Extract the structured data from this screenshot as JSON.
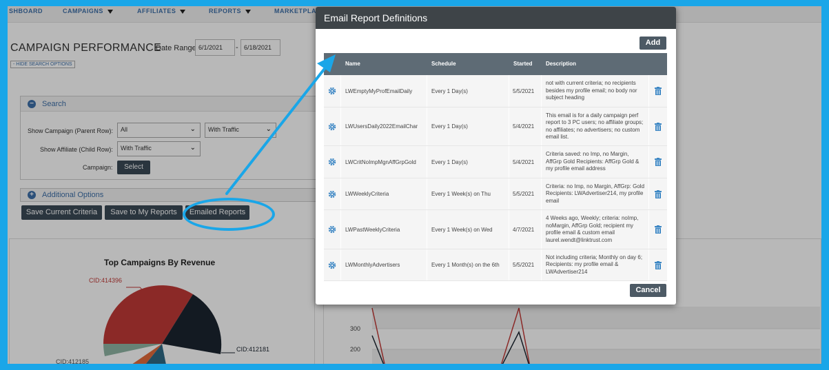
{
  "nav": {
    "items": [
      "SHBOARD",
      "CAMPAIGNS",
      "AFFILIATES",
      "REPORTS",
      "MARKETPLA"
    ]
  },
  "page": {
    "title": "CAMPAIGN PERFORMANCE",
    "date_range_label": "Date Range:",
    "date_from": "6/1/2021",
    "date_to": "6/18/2021",
    "date_sep": "-",
    "hide_search": "- HIDE SEARCH OPTIONS"
  },
  "search": {
    "title": "Search",
    "show_campaign_label": "Show Campaign (Parent Row):",
    "show_campaign_value": "All",
    "traffic_value": "With Traffic",
    "show_affiliate_label": "Show Affiliate (Child Row):",
    "show_affiliate_value": "With Traffic",
    "campaign_label": "Campaign:",
    "select_button": "Select"
  },
  "additional_options": {
    "title": "Additional Options"
  },
  "actions": {
    "save_criteria": "Save Current Criteria",
    "save_reports": "Save to My Reports",
    "emailed_reports": "Emailed Reports"
  },
  "chart": {
    "title": "Top Campaigns By Revenue",
    "labels": [
      "CID:414396",
      "CID:412181",
      "CID:412185"
    ],
    "axis_ticks": [
      "300",
      "200"
    ]
  },
  "modal": {
    "title": "Email Report Definitions",
    "add_button": "Add",
    "cancel_button": "Cancel",
    "columns": [
      "Name",
      "Schedule",
      "Started",
      "Description"
    ],
    "rows": [
      {
        "name": "LWEmptyMyProfEmailDaily",
        "schedule": "Every 1 Day(s)",
        "started": "5/5/2021",
        "description": "not with current criteria; no recipients besides my profile email; no body nor subject heading"
      },
      {
        "name": "LWUsersDaily2022EmailChar",
        "schedule": "Every 1 Day(s)",
        "started": "5/4/2021",
        "description": "This email is for a daily campaign perf report to 3 PC users; no affiliate groups; no affiliates; no advertisers; no custom email list."
      },
      {
        "name": "LWCritNoImpMgnAffGrpGold",
        "schedule": "Every 1 Day(s)",
        "started": "5/4/2021",
        "description": "Criteria saved: no Imp, no Margin, AffGrp Gold Recipients: AffGrp Gold & my profile email address"
      },
      {
        "name": "LWWeeklyCriteria",
        "schedule": "Every 1 Week(s) on Thu",
        "started": "5/5/2021",
        "description": "Criteria: no Imp, no Margin, AffGrp: Gold Recipients: LWAdvertiser214, my profile email"
      },
      {
        "name": "LWPastWeeklyCriteria",
        "schedule": "Every 1 Week(s) on Wed",
        "started": "4/7/2021",
        "description": "4 Weeks ago, Weekly; criteria: noImp, noMargin, AffGrp Gold; recipient my profile email & custom email laurel.wendt@linktrust.com"
      },
      {
        "name": "LWMonthlyAdvertisers",
        "schedule": "Every 1 Month(s) on the 6th",
        "started": "5/5/2021",
        "description": "Not including criteria; Monthly on day 6; Recipients: my profile email & LWAdvertiser214"
      }
    ]
  },
  "colors": {
    "frame": "#1aa6e8",
    "modal_header": "#3e4448",
    "grid_header": "#5e6b75",
    "button": "#4d5a65",
    "icon_blue": "#3d87c4"
  }
}
